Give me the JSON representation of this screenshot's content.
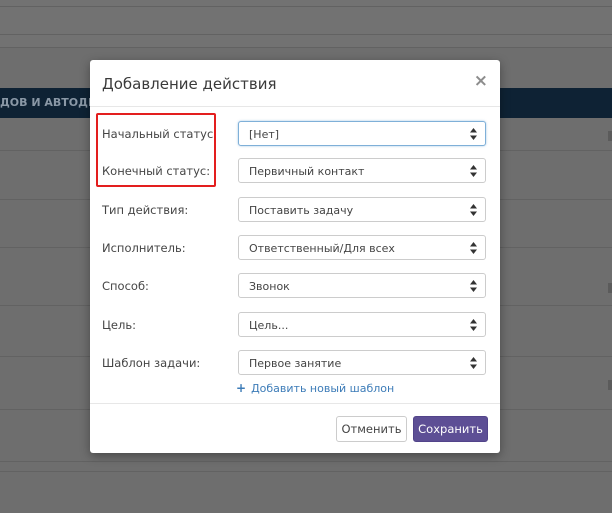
{
  "background": {
    "table_header": "ДОВ И АВТОДЕЙС"
  },
  "modal": {
    "title": "Добавление действия",
    "close_glyph": "×",
    "fields": [
      {
        "label": "Начальный статус:",
        "value": "[Нет]"
      },
      {
        "label": "Конечный статус:",
        "value": "Первичный контакт"
      },
      {
        "label": "Тип действия:",
        "value": "Поставить задачу"
      },
      {
        "label": "Исполнитель:",
        "value": "Ответственный/Для всех"
      },
      {
        "label": "Способ:",
        "value": "Звонок"
      },
      {
        "label": "Цель:",
        "value": "Цель..."
      },
      {
        "label": "Шаблон задачи:",
        "value": "Первое занятие"
      }
    ],
    "add_template": {
      "icon": "+",
      "label": "Добавить новый шаблон"
    },
    "buttons": {
      "cancel": "Отменить",
      "save": "Сохранить"
    }
  },
  "colors": {
    "highlight": "#e31e1e",
    "primary_button": "#5d4f95",
    "link": "#3d7cb8",
    "background_header": "#0e2234"
  },
  "icons": {
    "close": "close-icon",
    "select_arrows": "sort-arrows-icon",
    "add": "plus-icon"
  }
}
